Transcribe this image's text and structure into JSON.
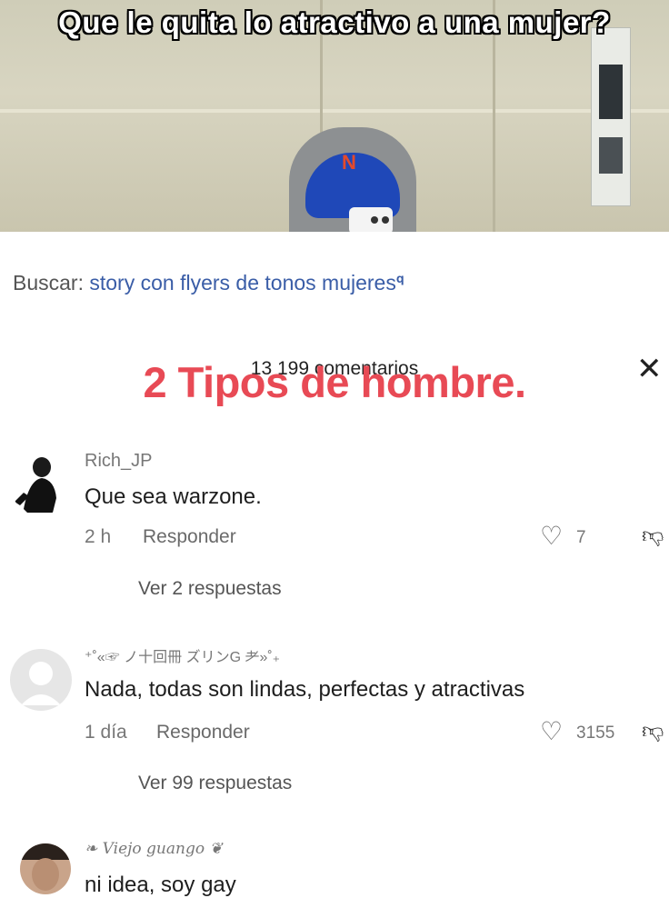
{
  "video": {
    "caption": "Que le quita lo atractivo a una mujer?"
  },
  "search": {
    "label": "Buscar:",
    "query": "story con flyers de tonos mujeres",
    "icon": "search-icon"
  },
  "comments_header": {
    "count_text": "13 199 comentarios",
    "close_icon": "close-icon"
  },
  "overlay_text": "2 Tipos de hombre.",
  "comments": [
    {
      "username": "Rich_JP",
      "text": "Que sea warzone.",
      "time": "2 h",
      "reply_label": "Responder",
      "likes": "7",
      "view_replies": "Ver 2 respuestas"
    },
    {
      "username": "⁺˚«☞ ノ十回冊  ズリンG ⺹»˚₊",
      "text": "Nada, todas son lindas, perfectas y atractivas",
      "time": "1 día",
      "reply_label": "Responder",
      "likes": "3155",
      "view_replies": "Ver 99 respuestas"
    },
    {
      "username": "Viejo guango",
      "text": "ni idea, soy gay"
    }
  ],
  "colors": {
    "overlay": "#e84a55",
    "search_query": "#3a5da7"
  }
}
